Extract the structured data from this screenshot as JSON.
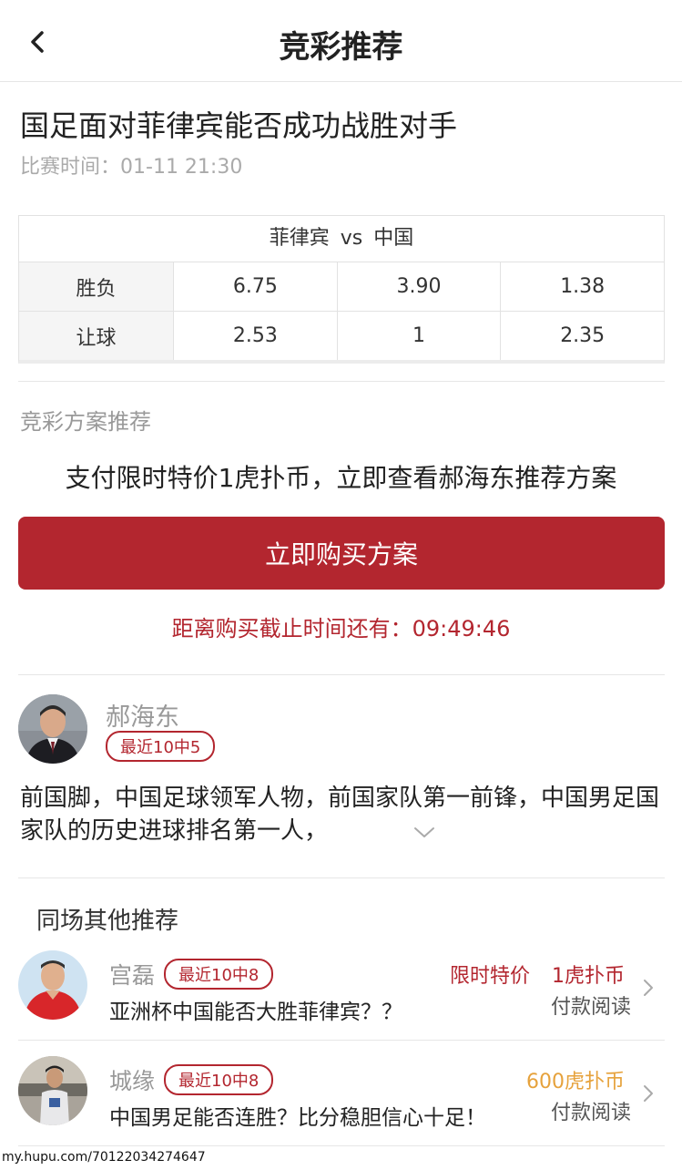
{
  "header": {
    "title": "竞彩推荐"
  },
  "match": {
    "title": "国足面对菲律宾能否成功战胜对手",
    "time_label": "比赛时间：",
    "time_value": "01-11 21:30"
  },
  "odds": {
    "home": "菲律宾",
    "vs": "vs",
    "away": "中国",
    "rows": [
      {
        "label": "胜负",
        "values": [
          "6.75",
          "3.90",
          "1.38"
        ]
      },
      {
        "label": "让球",
        "values": [
          "2.53",
          "1",
          "2.35"
        ]
      }
    ]
  },
  "plan": {
    "section_label": "竞彩方案推荐",
    "promo_text": "支付限时特价1虎扑币，立即查看郝海东推荐方案",
    "buy_button": "立即购买方案",
    "countdown_label": "距离购买截止时间还有：",
    "countdown_value": "09:49:46"
  },
  "expert": {
    "name": "郝海东",
    "record": "最近10中5",
    "description": "前国脚，中国足球领军人物，前国家队第一前锋，中国男足国家队的历史进球排名第一人，"
  },
  "others": {
    "title": "同场其他推荐",
    "items": [
      {
        "name": "宫磊",
        "record": "最近10中8",
        "question": "亚洲杯中国能否大胜菲律宾？？",
        "tag": "限时特价",
        "price": "1虎扑币",
        "price_color": "#b3262f",
        "pay_label": "付款阅读"
      },
      {
        "name": "城缘",
        "record": "最近10中8",
        "question": "中国男足能否连胜？比分稳胆信心十足！",
        "tag": "",
        "price": "600虎扑币",
        "price_color": "#e6a23c",
        "pay_label": "付款阅读"
      }
    ]
  },
  "watermark": "my.hupu.com/70122034274647",
  "colors": {
    "accent": "#b3262f",
    "price_gold": "#e6a23c"
  }
}
